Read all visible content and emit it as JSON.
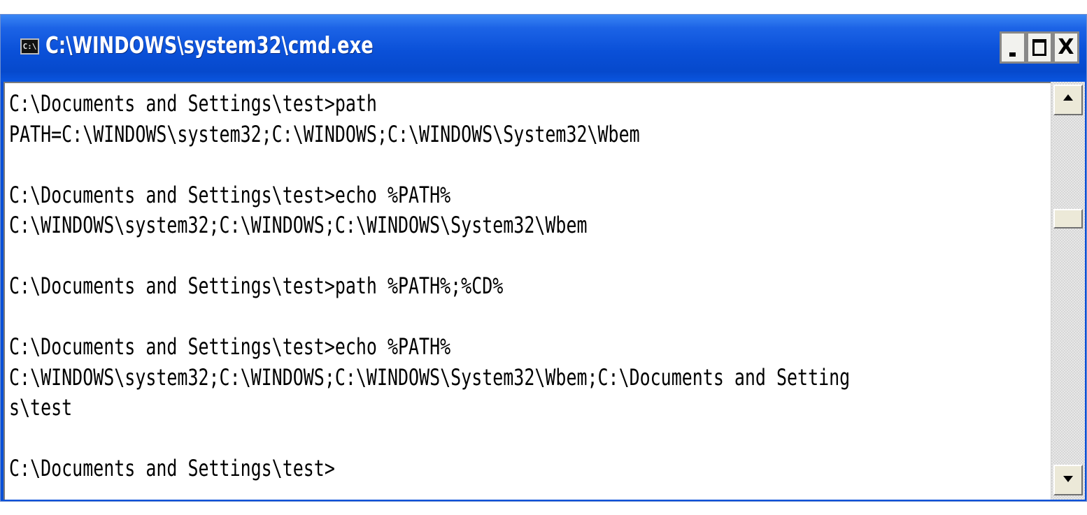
{
  "window": {
    "title": "C:\\WINDOWS\\system32\\cmd.exe",
    "icon": "cmd-console-icon",
    "icon_text": "C:\\",
    "controls": {
      "minimize": "minimize-icon",
      "maximize": "maximize-icon",
      "close_label": "X"
    }
  },
  "console": {
    "lines": [
      "C:\\Documents and Settings\\test>path",
      "PATH=C:\\WINDOWS\\system32;C:\\WINDOWS;C:\\WINDOWS\\System32\\Wbem",
      "",
      "C:\\Documents and Settings\\test>echo %PATH%",
      "C:\\WINDOWS\\system32;C:\\WINDOWS;C:\\WINDOWS\\System32\\Wbem",
      "",
      "C:\\Documents and Settings\\test>path %PATH%;%CD%",
      "",
      "C:\\Documents and Settings\\test>echo %PATH%",
      "C:\\WINDOWS\\system32;C:\\WINDOWS;C:\\WINDOWS\\System32\\Wbem;C:\\Documents and Setting",
      "s\\test",
      "",
      "C:\\Documents and Settings\\test>"
    ]
  },
  "scrollbar": {
    "up_icon": "scroll-up-arrow-icon",
    "down_icon": "scroll-down-arrow-icon",
    "position": 0.23
  },
  "colors": {
    "titlebar": "#0a50d8",
    "console_background": "#ffffff",
    "console_text": "#000000"
  }
}
